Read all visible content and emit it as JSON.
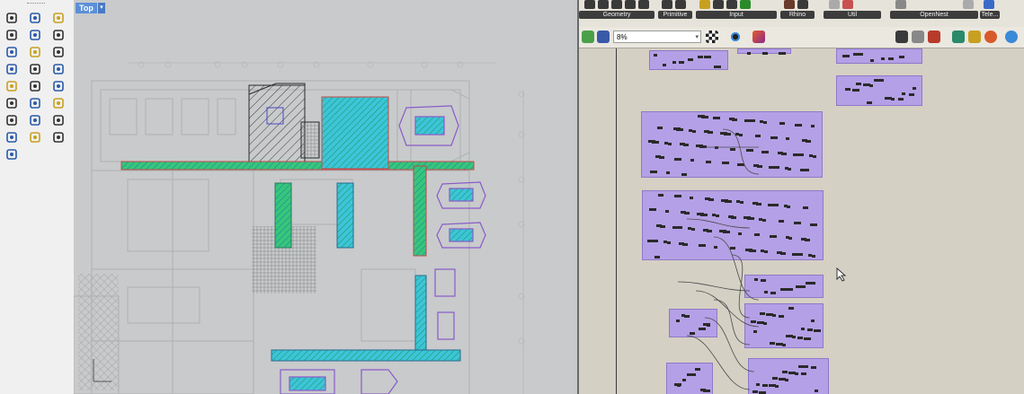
{
  "viewport": {
    "name": "Top"
  },
  "ribbon": {
    "groups": [
      "Geometry",
      "Primitive",
      "Input",
      "Rhino",
      "Util",
      "OpenNest",
      "Tele..."
    ]
  },
  "toolbar": {
    "zoom": "8%"
  },
  "colors": {
    "viewport_bg": "#c8cacc",
    "hatch_green": "#35c77a",
    "hatch_cyan": "#3bc6d9",
    "outline_red": "#c44848",
    "cluster_purple": "#b4a0e6",
    "canvas_bg": "#d4d0c4",
    "tab_blue": "#5b8fd9"
  },
  "icons": [
    "select-arrow-icon",
    "point-icon",
    "polyline-icon",
    "curve-icon",
    "circle-icon",
    "arc-icon",
    "rectangle-icon",
    "polygon-icon",
    "surface-icon",
    "extrude-icon",
    "box-icon",
    "sphere-icon",
    "boolean-icon",
    "fillet-icon",
    "trim-icon",
    "split-icon",
    "move-icon",
    "rotate-icon",
    "scale-icon",
    "array-icon",
    "mirror-icon",
    "group-icon",
    "check-icon",
    "mesh-icon",
    "render-icon"
  ]
}
